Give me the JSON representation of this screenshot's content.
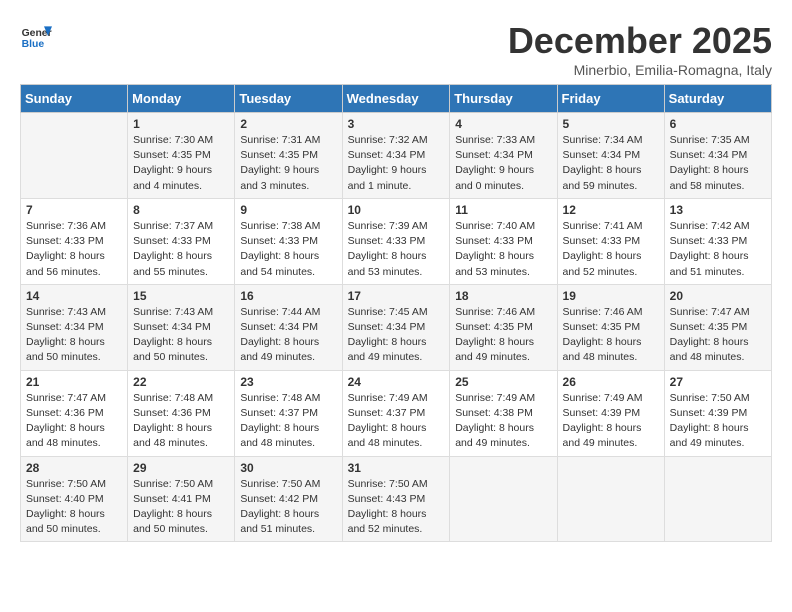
{
  "header": {
    "logo_line1": "General",
    "logo_line2": "Blue",
    "month": "December 2025",
    "location": "Minerbio, Emilia-Romagna, Italy"
  },
  "weekdays": [
    "Sunday",
    "Monday",
    "Tuesday",
    "Wednesday",
    "Thursday",
    "Friday",
    "Saturday"
  ],
  "weeks": [
    [
      {
        "day": "",
        "info": ""
      },
      {
        "day": "1",
        "info": "Sunrise: 7:30 AM\nSunset: 4:35 PM\nDaylight: 9 hours\nand 4 minutes."
      },
      {
        "day": "2",
        "info": "Sunrise: 7:31 AM\nSunset: 4:35 PM\nDaylight: 9 hours\nand 3 minutes."
      },
      {
        "day": "3",
        "info": "Sunrise: 7:32 AM\nSunset: 4:34 PM\nDaylight: 9 hours\nand 1 minute."
      },
      {
        "day": "4",
        "info": "Sunrise: 7:33 AM\nSunset: 4:34 PM\nDaylight: 9 hours\nand 0 minutes."
      },
      {
        "day": "5",
        "info": "Sunrise: 7:34 AM\nSunset: 4:34 PM\nDaylight: 8 hours\nand 59 minutes."
      },
      {
        "day": "6",
        "info": "Sunrise: 7:35 AM\nSunset: 4:34 PM\nDaylight: 8 hours\nand 58 minutes."
      }
    ],
    [
      {
        "day": "7",
        "info": "Sunrise: 7:36 AM\nSunset: 4:33 PM\nDaylight: 8 hours\nand 56 minutes."
      },
      {
        "day": "8",
        "info": "Sunrise: 7:37 AM\nSunset: 4:33 PM\nDaylight: 8 hours\nand 55 minutes."
      },
      {
        "day": "9",
        "info": "Sunrise: 7:38 AM\nSunset: 4:33 PM\nDaylight: 8 hours\nand 54 minutes."
      },
      {
        "day": "10",
        "info": "Sunrise: 7:39 AM\nSunset: 4:33 PM\nDaylight: 8 hours\nand 53 minutes."
      },
      {
        "day": "11",
        "info": "Sunrise: 7:40 AM\nSunset: 4:33 PM\nDaylight: 8 hours\nand 53 minutes."
      },
      {
        "day": "12",
        "info": "Sunrise: 7:41 AM\nSunset: 4:33 PM\nDaylight: 8 hours\nand 52 minutes."
      },
      {
        "day": "13",
        "info": "Sunrise: 7:42 AM\nSunset: 4:33 PM\nDaylight: 8 hours\nand 51 minutes."
      }
    ],
    [
      {
        "day": "14",
        "info": "Sunrise: 7:43 AM\nSunset: 4:34 PM\nDaylight: 8 hours\nand 50 minutes."
      },
      {
        "day": "15",
        "info": "Sunrise: 7:43 AM\nSunset: 4:34 PM\nDaylight: 8 hours\nand 50 minutes."
      },
      {
        "day": "16",
        "info": "Sunrise: 7:44 AM\nSunset: 4:34 PM\nDaylight: 8 hours\nand 49 minutes."
      },
      {
        "day": "17",
        "info": "Sunrise: 7:45 AM\nSunset: 4:34 PM\nDaylight: 8 hours\nand 49 minutes."
      },
      {
        "day": "18",
        "info": "Sunrise: 7:46 AM\nSunset: 4:35 PM\nDaylight: 8 hours\nand 49 minutes."
      },
      {
        "day": "19",
        "info": "Sunrise: 7:46 AM\nSunset: 4:35 PM\nDaylight: 8 hours\nand 48 minutes."
      },
      {
        "day": "20",
        "info": "Sunrise: 7:47 AM\nSunset: 4:35 PM\nDaylight: 8 hours\nand 48 minutes."
      }
    ],
    [
      {
        "day": "21",
        "info": "Sunrise: 7:47 AM\nSunset: 4:36 PM\nDaylight: 8 hours\nand 48 minutes."
      },
      {
        "day": "22",
        "info": "Sunrise: 7:48 AM\nSunset: 4:36 PM\nDaylight: 8 hours\nand 48 minutes."
      },
      {
        "day": "23",
        "info": "Sunrise: 7:48 AM\nSunset: 4:37 PM\nDaylight: 8 hours\nand 48 minutes."
      },
      {
        "day": "24",
        "info": "Sunrise: 7:49 AM\nSunset: 4:37 PM\nDaylight: 8 hours\nand 48 minutes."
      },
      {
        "day": "25",
        "info": "Sunrise: 7:49 AM\nSunset: 4:38 PM\nDaylight: 8 hours\nand 49 minutes."
      },
      {
        "day": "26",
        "info": "Sunrise: 7:49 AM\nSunset: 4:39 PM\nDaylight: 8 hours\nand 49 minutes."
      },
      {
        "day": "27",
        "info": "Sunrise: 7:50 AM\nSunset: 4:39 PM\nDaylight: 8 hours\nand 49 minutes."
      }
    ],
    [
      {
        "day": "28",
        "info": "Sunrise: 7:50 AM\nSunset: 4:40 PM\nDaylight: 8 hours\nand 50 minutes."
      },
      {
        "day": "29",
        "info": "Sunrise: 7:50 AM\nSunset: 4:41 PM\nDaylight: 8 hours\nand 50 minutes."
      },
      {
        "day": "30",
        "info": "Sunrise: 7:50 AM\nSunset: 4:42 PM\nDaylight: 8 hours\nand 51 minutes."
      },
      {
        "day": "31",
        "info": "Sunrise: 7:50 AM\nSunset: 4:43 PM\nDaylight: 8 hours\nand 52 minutes."
      },
      {
        "day": "",
        "info": ""
      },
      {
        "day": "",
        "info": ""
      },
      {
        "day": "",
        "info": ""
      }
    ]
  ]
}
